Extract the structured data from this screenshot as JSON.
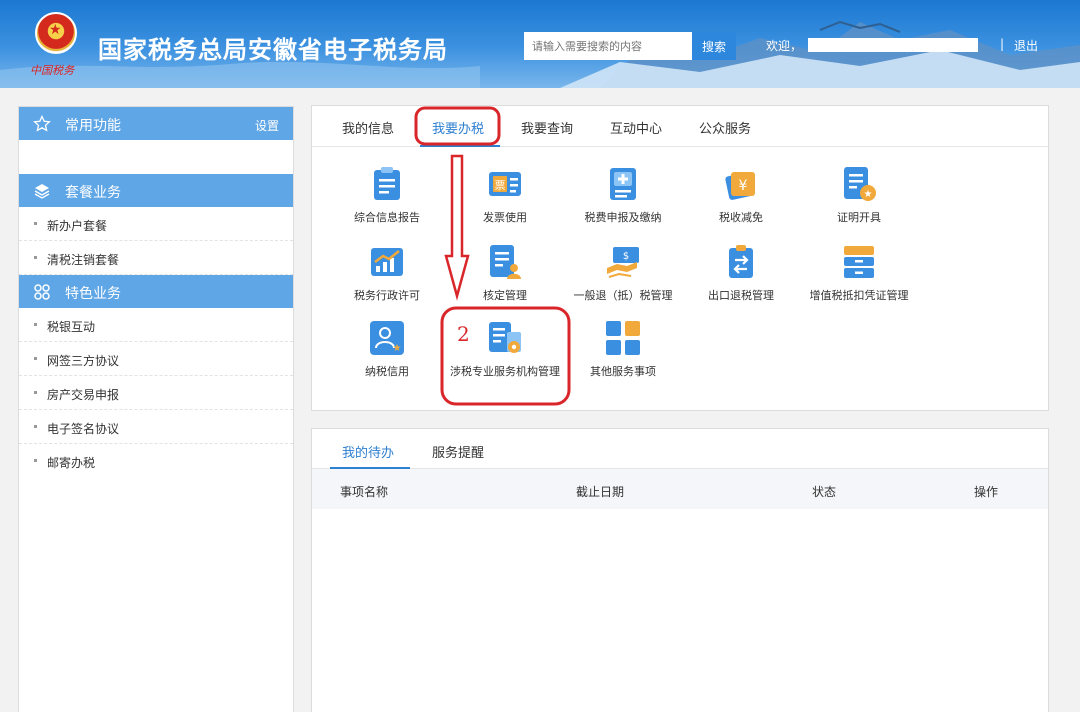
{
  "header": {
    "title": "国家税务总局安徽省电子税务局",
    "brand": "中国税务",
    "search_placeholder": "请输入需要搜索的内容",
    "search_label": "搜索",
    "welcome": "欢迎，",
    "separator": "|",
    "logout": "退出"
  },
  "sidebar": {
    "common": {
      "label": "常用功能",
      "settings": "设置"
    },
    "package": {
      "label": "套餐业务",
      "items": [
        "新办户套餐",
        "清税注销套餐"
      ]
    },
    "special": {
      "label": "特色业务",
      "items": [
        "税银互动",
        "网签三方协议",
        "房产交易申报",
        "电子签名协议",
        "邮寄办税"
      ]
    }
  },
  "main": {
    "tabs": [
      "我的信息",
      "我要办税",
      "我要查询",
      "互动中心",
      "公众服务"
    ],
    "active_tab": "我要办税",
    "services": [
      {
        "label": "综合信息报告",
        "icon": "report-icon"
      },
      {
        "label": "发票使用",
        "icon": "invoice-icon"
      },
      {
        "label": "税费申报及缴纳",
        "icon": "declare-icon"
      },
      {
        "label": "税收减免",
        "icon": "tax-relief-icon"
      },
      {
        "label": "证明开具",
        "icon": "certificate-icon"
      },
      {
        "label": "税务行政许可",
        "icon": "license-chart-icon"
      },
      {
        "label": "核定管理",
        "icon": "approval-icon"
      },
      {
        "label": "一般退（抵）税管理",
        "icon": "refund-icon"
      },
      {
        "label": "出口退税管理",
        "icon": "export-refund-icon"
      },
      {
        "label": "增值税抵扣凭证管理",
        "icon": "vat-voucher-icon"
      },
      {
        "label": "纳税信用",
        "icon": "credit-icon"
      },
      {
        "label": "涉税专业服务机构管理",
        "icon": "agency-icon"
      },
      {
        "label": "其他服务事项",
        "icon": "other-services-icon"
      }
    ]
  },
  "todo": {
    "tabs": [
      "我的待办",
      "服务提醒"
    ],
    "active_tab": "我的待办",
    "columns": [
      "事项名称",
      "截止日期",
      "状态",
      "操作"
    ]
  },
  "annotation": {
    "step_number": "2"
  },
  "colors": {
    "accent": "#2d7fd0",
    "sidebar_head": "#5fa6e6",
    "annotation": "#d9262a"
  }
}
